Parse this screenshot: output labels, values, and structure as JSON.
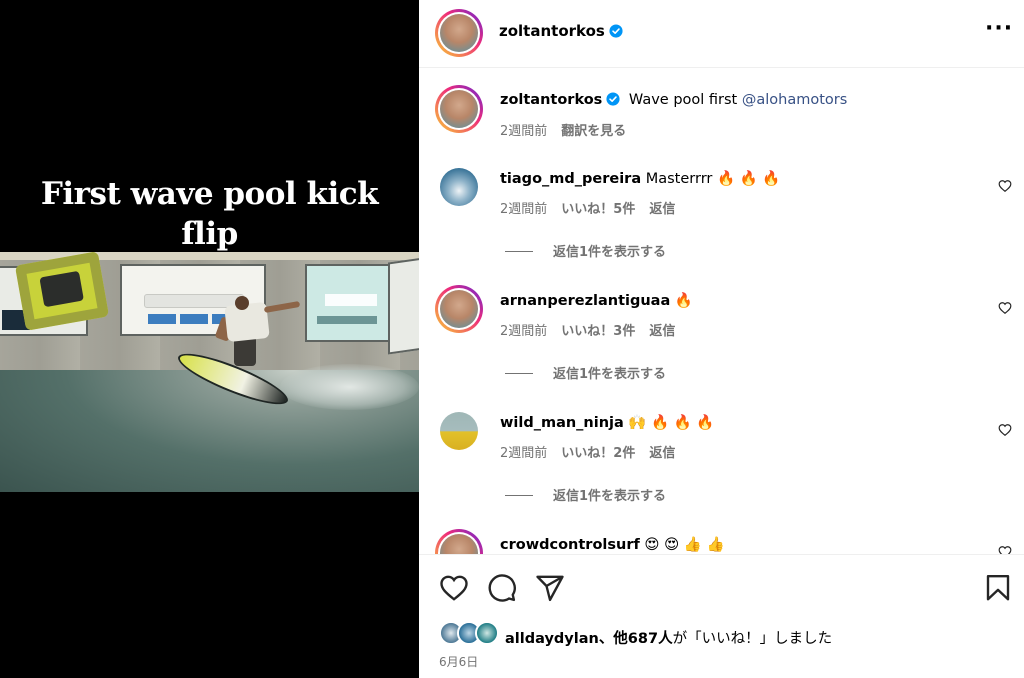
{
  "media": {
    "caption_line1": "First wave pool kick",
    "caption_line2": "flip"
  },
  "header": {
    "username": "zoltantorkos",
    "verified": true,
    "more_icon": "more-horizontal-icon"
  },
  "post_caption": {
    "username": "zoltantorkos",
    "text": "Wave pool first",
    "mention": "@alohamotors",
    "time": "2週間前",
    "translate_label": "翻訳を見る"
  },
  "comments": [
    {
      "username": "tiago_md_pereira",
      "text": "Masterrrr 🔥 🔥 🔥",
      "time": "2週間前",
      "likes": "いいね！5件",
      "reply_label": "返信",
      "view_replies": "返信1件を表示する"
    },
    {
      "username": "arnanperezlantiguaa",
      "text": "🔥",
      "time": "2週間前",
      "likes": "いいね！3件",
      "reply_label": "返信",
      "view_replies": "返信1件を表示する"
    },
    {
      "username": "wild_man_ninja",
      "text": "🙌 🔥 🔥 🔥",
      "time": "2週間前",
      "likes": "いいね！2件",
      "reply_label": "返信",
      "view_replies": "返信1件を表示する"
    },
    {
      "username": "crowdcontrolsurf",
      "text": "😍 😍 👍 👍"
    }
  ],
  "actions": {
    "like_icon": "heart-icon",
    "comment_icon": "comment-icon",
    "share_icon": "send-icon",
    "save_icon": "bookmark-icon"
  },
  "likes_summary": {
    "first_user": "alldaydylan",
    "rest": "、他687人",
    "suffix": "が「いいね！」しました"
  },
  "post_date": "6月6日",
  "colors": {
    "link": "#385185",
    "verified": "#0095f6",
    "muted": "#737373"
  }
}
